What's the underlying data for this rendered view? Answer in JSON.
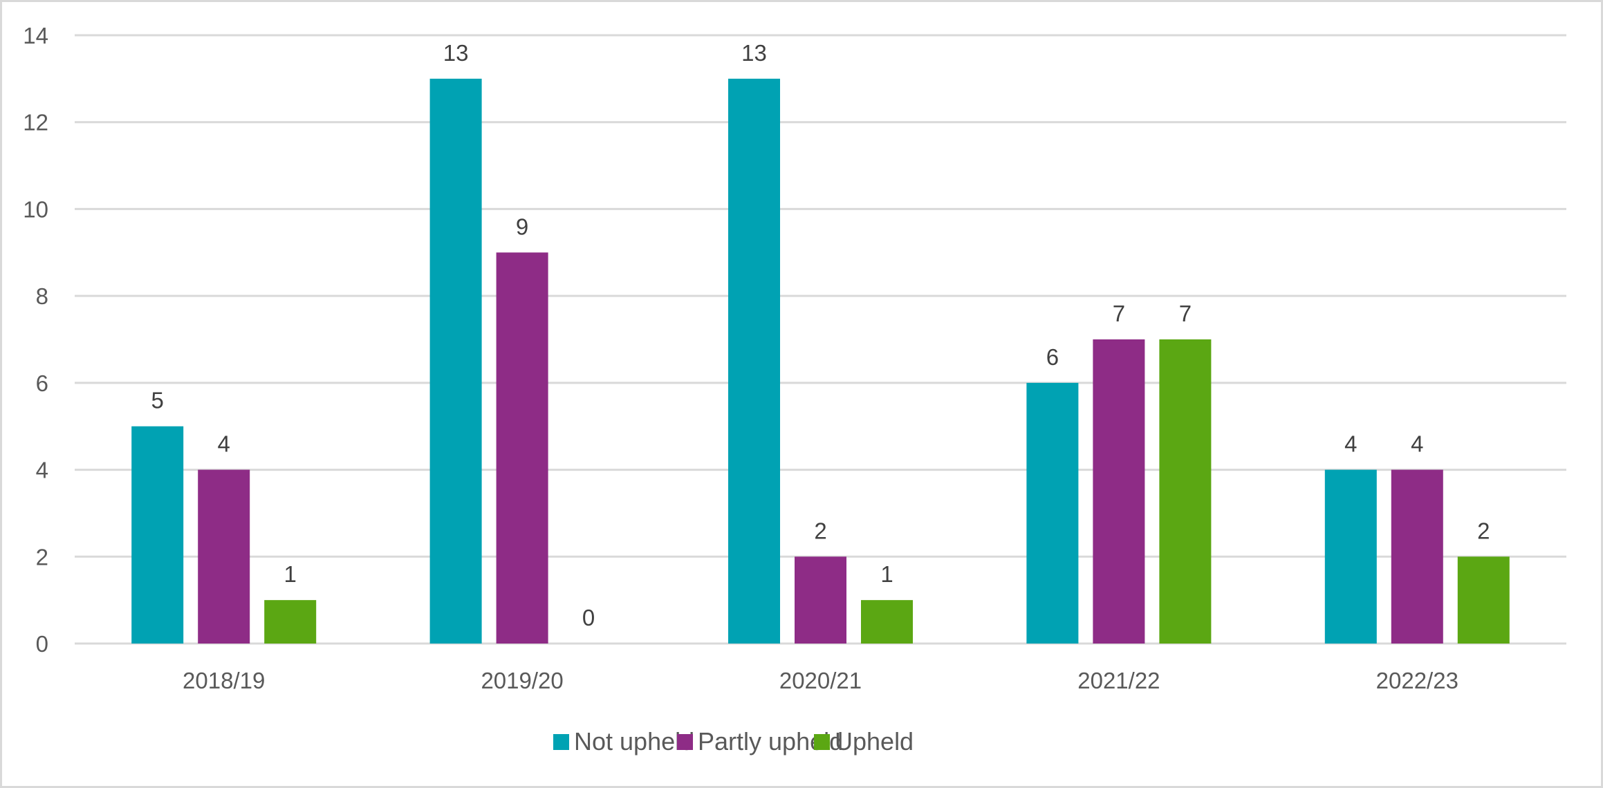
{
  "chart_data": {
    "type": "bar",
    "title": "",
    "xlabel": "",
    "ylabel": "",
    "categories": [
      "2018/19",
      "2019/20",
      "2020/21",
      "2021/22",
      "2022/23"
    ],
    "series": [
      {
        "name": "Not upheld",
        "color": "#00A2B3",
        "values": [
          5,
          13,
          13,
          6,
          4
        ]
      },
      {
        "name": "Partly upheld",
        "color": "#8E2C86",
        "values": [
          4,
          9,
          2,
          7,
          4
        ]
      },
      {
        "name": "Upheld",
        "color": "#5BA713",
        "values": [
          1,
          0,
          1,
          7,
          2
        ]
      }
    ],
    "ylim": [
      0,
      14
    ],
    "yticks": [
      0,
      2,
      4,
      6,
      8,
      10,
      12,
      14
    ],
    "grid": true,
    "data_labels": true,
    "legend_position": "bottom"
  }
}
